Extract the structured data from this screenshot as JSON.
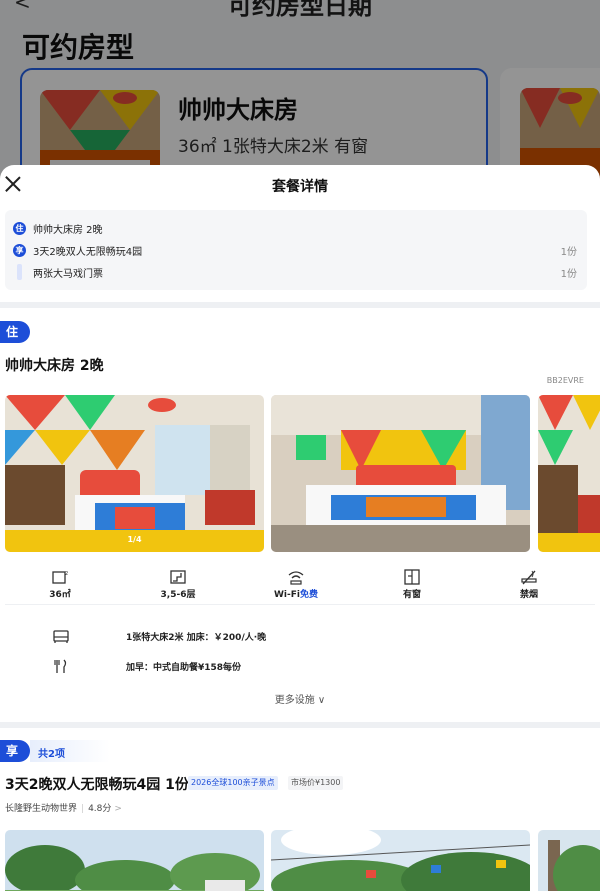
{
  "background": {
    "back_glyph": "<",
    "page_title": "可约房型日期",
    "section_title": "可约房型",
    "card": {
      "room_name": "帅帅大床房",
      "room_spec": "36㎡ 1张特大床2米 有窗"
    }
  },
  "sheet": {
    "title": "套餐详情",
    "summary": [
      {
        "icon": "住",
        "text": "帅帅大床房 2晚",
        "qty": ""
      },
      {
        "icon": "享",
        "text": "3天2晚双人无限畅玩4园",
        "qty": "1份"
      },
      {
        "icon": "",
        "text": "两张大马戏门票",
        "qty": "1份"
      }
    ],
    "stay": {
      "tag": "住",
      "title": "帅帅大床房 2晚",
      "code": "BB2EVRE",
      "photo_counter": "1/4",
      "facilities": [
        {
          "icon": "area-icon",
          "label": "36㎡"
        },
        {
          "icon": "floor-icon",
          "label": "3,5-6层"
        },
        {
          "icon": "wifi-icon",
          "label": "Wi-Fi",
          "label_highlight": "免费"
        },
        {
          "icon": "window-icon",
          "label": "有窗"
        },
        {
          "icon": "no-smoking-icon",
          "label": "禁烟"
        }
      ],
      "details": [
        {
          "icon": "bed-icon",
          "text": "1张特大床2米 加床：￥200/人·晚"
        },
        {
          "icon": "breakfast-icon",
          "text": "加早：中式自助餐¥158每份"
        }
      ],
      "more_link": "更多设施 ∨"
    },
    "enjoy": {
      "tag": "享",
      "count": "共2项",
      "title": "3天2晚双人无限畅玩4园 1份",
      "badge_blue": "2026全球100亲子景点",
      "badge_gray": "市场价¥1300",
      "sub_place": "长隆野生动物世界",
      "sub_score": "4.8分",
      "sub_arrow": ">"
    }
  },
  "colors": {
    "accent": "#1d4ed8",
    "overlay": "rgba(0,0,0,0.42)"
  }
}
